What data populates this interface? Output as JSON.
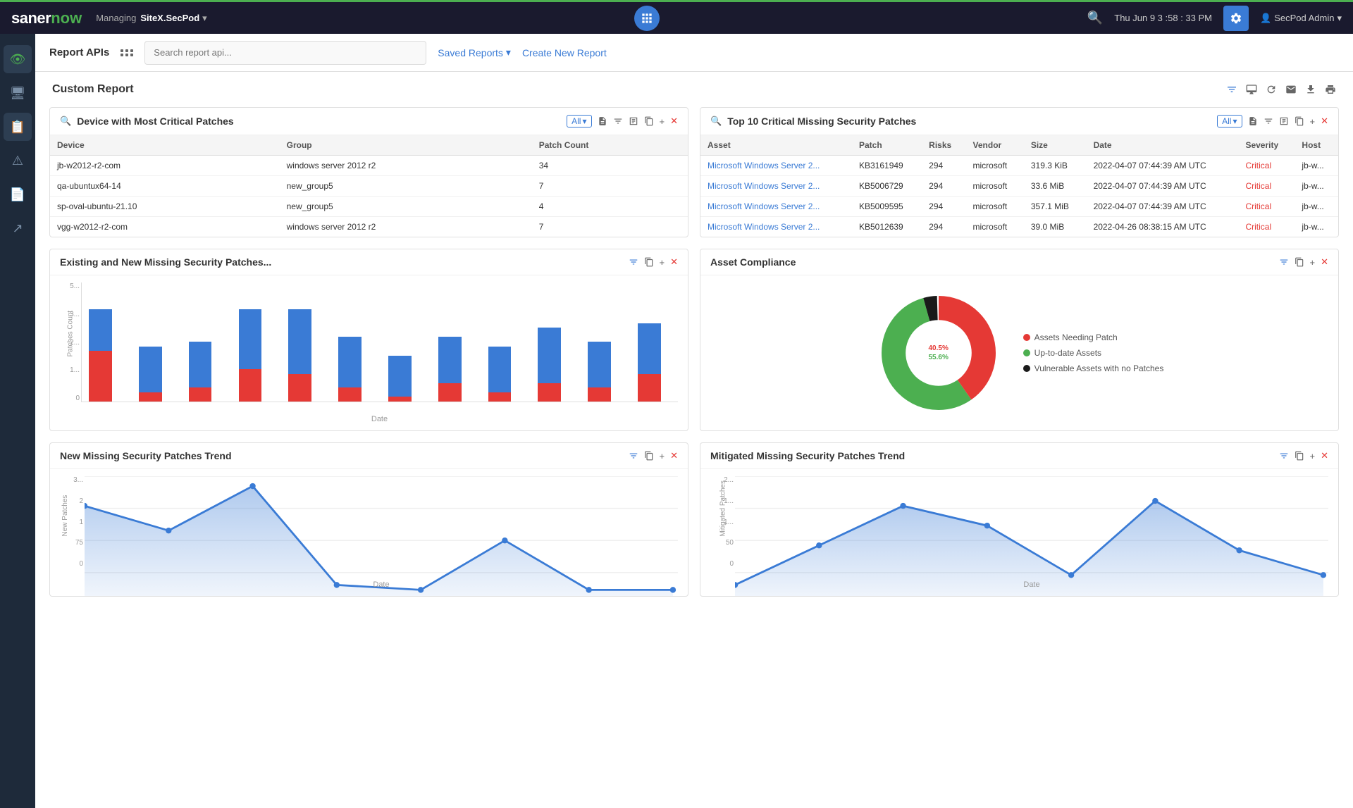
{
  "topNav": {
    "logoSaner": "saner",
    "logoNow": "now",
    "managingLabel": "Managing",
    "siteLabel": "SiteX.SecPod",
    "gridIconLabel": "apps",
    "searchIconLabel": "🔍",
    "timeLabel": "Thu Jun 9  3 :58 : 33 PM",
    "settingsLabel": "⚙",
    "userLabel": "SecPod Admin"
  },
  "sidebar": {
    "items": [
      {
        "icon": "👁",
        "name": "visibility"
      },
      {
        "icon": "🖥",
        "name": "devices"
      },
      {
        "icon": "📋",
        "name": "reports"
      },
      {
        "icon": "⚠",
        "name": "alerts"
      },
      {
        "icon": "📄",
        "name": "documents"
      },
      {
        "icon": "↗",
        "name": "export"
      }
    ]
  },
  "subHeader": {
    "reportApisLabel": "Report APIs",
    "searchPlaceholder": "Search report api...",
    "savedReportsLabel": "Saved Reports",
    "createReportLabel": "Create New Report"
  },
  "customReport": {
    "title": "Custom Report"
  },
  "headerActions": {
    "filterIcon": "filter",
    "monitorIcon": "monitor",
    "refreshIcon": "refresh",
    "emailIcon": "email",
    "downloadIcon": "download",
    "printIcon": "print"
  },
  "widgets": {
    "devicePatches": {
      "title": "Device with Most Critical Patches",
      "searchIcon": "🔍",
      "allLabel": "All",
      "columns": [
        "Device",
        "Group",
        "Patch Count"
      ],
      "rows": [
        [
          "jb-w2012-r2-com",
          "windows server 2012 r2",
          "34"
        ],
        [
          "qa-ubuntux64-14",
          "new_group5",
          "7"
        ],
        [
          "sp-oval-ubuntu-21.10",
          "new_group5",
          "4"
        ],
        [
          "vgg-w2012-r2-com",
          "windows server 2012 r2",
          "7"
        ]
      ]
    },
    "criticalPatches": {
      "title": "Top 10 Critical Missing Security Patches",
      "searchIcon": "🔍",
      "allLabel": "All",
      "columns": [
        "Asset",
        "Patch",
        "Risks",
        "Vendor",
        "Size",
        "Date",
        "Severity",
        "Host"
      ],
      "rows": [
        [
          "Microsoft Windows Server 2...",
          "KB3161949",
          "294",
          "microsoft",
          "319.3 KiB",
          "2022-04-07 07:44:39 AM UTC",
          "Critical",
          "jb-w..."
        ],
        [
          "Microsoft Windows Server 2...",
          "KB5006729",
          "294",
          "microsoft",
          "33.6 MiB",
          "2022-04-07 07:44:39 AM UTC",
          "Critical",
          "jb-w..."
        ],
        [
          "Microsoft Windows Server 2...",
          "KB5009595",
          "294",
          "microsoft",
          "357.1 MiB",
          "2022-04-07 07:44:39 AM UTC",
          "Critical",
          "jb-w..."
        ],
        [
          "Microsoft Windows Server 2...",
          "KB5012639",
          "294",
          "microsoft",
          "39.0 MiB",
          "2022-04-26 08:38:15 AM UTC",
          "Critical",
          "jb-w..."
        ]
      ]
    },
    "missingPatches": {
      "title": "Existing and New Missing Security Patches...",
      "yLabel": "Patches Count",
      "xLabel": "Date",
      "yAxisLabels": [
        "5...",
        "3...",
        "2...",
        "1...",
        "0"
      ],
      "bars": [
        {
          "blue": 45,
          "red": 55
        },
        {
          "blue": 50,
          "red": 10
        },
        {
          "blue": 50,
          "red": 15
        },
        {
          "blue": 65,
          "red": 35
        },
        {
          "blue": 70,
          "red": 30
        },
        {
          "blue": 55,
          "red": 15
        },
        {
          "blue": 45,
          "red": 5
        },
        {
          "blue": 50,
          "red": 20
        },
        {
          "blue": 50,
          "red": 10
        },
        {
          "blue": 60,
          "red": 20
        },
        {
          "blue": 50,
          "red": 15
        },
        {
          "blue": 55,
          "red": 30
        }
      ]
    },
    "assetCompliance": {
      "title": "Asset Compliance",
      "segments": [
        {
          "label": "Assets Needing Patch",
          "color": "#e53935",
          "value": 40.5,
          "startAngle": 0
        },
        {
          "label": "Up-to-date Assets",
          "color": "#4caf50",
          "value": 55.6,
          "startAngle": 145
        },
        {
          "label": "Vulnerable Assets with no Patches",
          "color": "#1a1a1a",
          "value": 3.9,
          "startAngle": 345
        }
      ],
      "centerLabels": [
        "40.5%",
        "55.6%"
      ]
    },
    "newMissingTrend": {
      "title": "New Missing Security Patches Trend",
      "yLabel": "New Patches",
      "xLabel": "Date",
      "yAxisLabels": [
        "3...",
        "2",
        "1",
        "75",
        "0"
      ],
      "points": [
        100,
        75,
        130,
        20,
        15,
        80,
        20,
        15
      ]
    },
    "mitigatedTrend": {
      "title": "Mitigated Missing Security Patches Trend",
      "yLabel": "Mitigated Patches",
      "xLabel": "Date",
      "yAxisLabels": [
        "2...",
        "1...",
        "1...",
        "50",
        "0"
      ],
      "points": [
        30,
        80,
        120,
        100,
        40,
        110,
        60,
        40
      ]
    }
  }
}
